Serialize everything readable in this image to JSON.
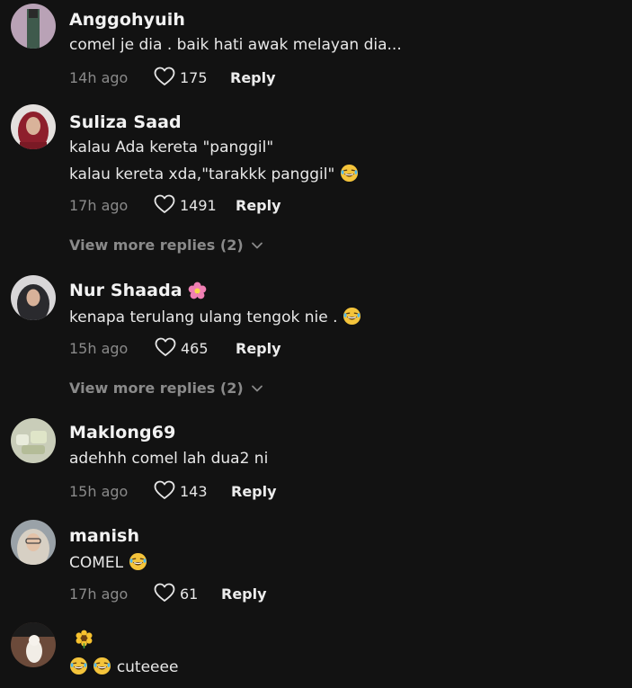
{
  "comments": [
    {
      "username": "Anggohyuih",
      "lines": [
        "comel je dia . baik hati awak melayan dia..."
      ],
      "time": "14h ago",
      "likes": "175",
      "reply_label": "Reply"
    },
    {
      "username": "Suliza Saad",
      "lines": [
        "kalau Ada kereta \"panggil\"",
        "kalau kereta xda,\"tarakkk panggil\""
      ],
      "time": "17h ago",
      "likes": "1491",
      "reply_label": "Reply",
      "view_more": "View more replies (2)"
    },
    {
      "username": "Nur Shaada",
      "lines": [
        "kenapa terulang ulang tengok nie ."
      ],
      "time": "15h ago",
      "likes": "465",
      "reply_label": "Reply",
      "view_more": "View more replies (2)"
    },
    {
      "username": "Maklong69",
      "lines": [
        "adehhh comel lah dua2 ni"
      ],
      "time": "15h ago",
      "likes": "143",
      "reply_label": "Reply"
    },
    {
      "username": "manish",
      "lines": [
        "COMEL"
      ],
      "time": "17h ago",
      "likes": "61",
      "reply_label": "Reply"
    },
    {
      "username": "",
      "lines": [
        "cuteeee"
      ]
    }
  ],
  "icons": {
    "heart": "heart-outline-icon",
    "chevron": "chevron-down-icon",
    "laugh": "laughing-emoji",
    "flower_pink": "pink-flower-emoji",
    "sunflower": "sunflower-emoji"
  },
  "colors": {
    "background": "#121212",
    "muted_text": "#8a8a8a",
    "primary_text": "#e8e8e8"
  }
}
